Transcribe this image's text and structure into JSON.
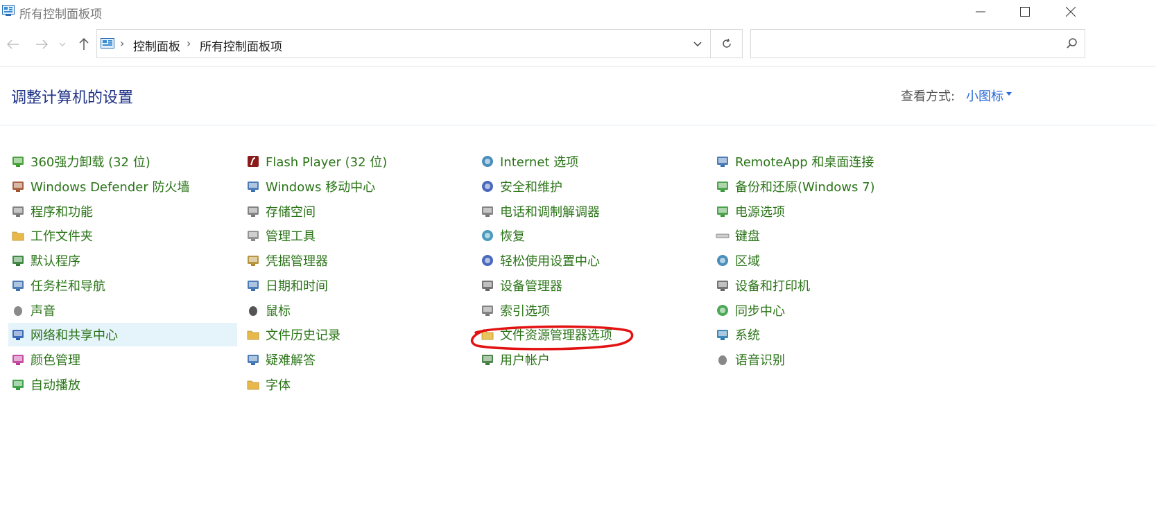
{
  "window": {
    "title": "所有控制面板项"
  },
  "address_bar": {
    "breadcrumbs": [
      "控制面板",
      "所有控制面板项"
    ]
  },
  "search": {
    "placeholder": ""
  },
  "header": {
    "title": "调整计算机的设置",
    "view_label": "查看方式:",
    "view_value": "小图标"
  },
  "columns": [
    {
      "items": [
        {
          "label": "360强力卸载 (32 位)",
          "icon": "uninstall-icon",
          "color": "#3a9a2a"
        },
        {
          "label": "Windows Defender 防火墙",
          "icon": "firewall-icon",
          "color": "#a0522d"
        },
        {
          "label": "程序和功能",
          "icon": "programs-icon",
          "color": "#777777"
        },
        {
          "label": "工作文件夹",
          "icon": "work-folder-icon",
          "color": "#e8b94a"
        },
        {
          "label": "默认程序",
          "icon": "default-programs-icon",
          "color": "#2e7d32"
        },
        {
          "label": "任务栏和导航",
          "icon": "taskbar-icon",
          "color": "#3a6fb0"
        },
        {
          "label": "声音",
          "icon": "speaker-icon",
          "color": "#8a8a8a"
        },
        {
          "label": "网络和共享中心",
          "icon": "network-icon",
          "color": "#2a5db0",
          "selected": true
        },
        {
          "label": "颜色管理",
          "icon": "color-management-icon",
          "color": "#c03a9a"
        },
        {
          "label": "自动播放",
          "icon": "autoplay-icon",
          "color": "#2e9a3a"
        }
      ]
    },
    {
      "items": [
        {
          "label": "Flash Player (32 位)",
          "icon": "flash-icon",
          "color": "#8b1a1a"
        },
        {
          "label": "Windows 移动中心",
          "icon": "mobility-center-icon",
          "color": "#3a6fb0"
        },
        {
          "label": "存储空间",
          "icon": "storage-icon",
          "color": "#777777"
        },
        {
          "label": "管理工具",
          "icon": "admin-tools-icon",
          "color": "#888888"
        },
        {
          "label": "凭据管理器",
          "icon": "credential-icon",
          "color": "#b08a2a"
        },
        {
          "label": "日期和时间",
          "icon": "calendar-icon",
          "color": "#3a6fb0"
        },
        {
          "label": "鼠标",
          "icon": "mouse-icon",
          "color": "#555555"
        },
        {
          "label": "文件历史记录",
          "icon": "file-history-icon",
          "color": "#e8b94a"
        },
        {
          "label": "疑难解答",
          "icon": "troubleshoot-icon",
          "color": "#3a6fb0"
        },
        {
          "label": "字体",
          "icon": "fonts-icon",
          "color": "#e8b94a"
        }
      ]
    },
    {
      "items": [
        {
          "label": "Internet 选项",
          "icon": "internet-options-icon",
          "color": "#2a7ab0"
        },
        {
          "label": "安全和维护",
          "icon": "flag-icon",
          "color": "#2a4db0"
        },
        {
          "label": "电话和调制解调器",
          "icon": "phone-icon",
          "color": "#777777"
        },
        {
          "label": "恢复",
          "icon": "recovery-icon",
          "color": "#2a8ab0"
        },
        {
          "label": "轻松使用设置中心",
          "icon": "ease-of-access-icon",
          "color": "#2a4db0"
        },
        {
          "label": "设备管理器",
          "icon": "device-manager-icon",
          "color": "#666666"
        },
        {
          "label": "索引选项",
          "icon": "indexing-icon",
          "color": "#777777"
        },
        {
          "label": "文件资源管理器选项",
          "icon": "folder-options-icon",
          "color": "#e8c45a"
        },
        {
          "label": "用户帐户",
          "icon": "user-accounts-icon",
          "color": "#3a7a3a"
        }
      ]
    },
    {
      "items": [
        {
          "label": "RemoteApp 和桌面连接",
          "icon": "remoteapp-icon",
          "color": "#3a6fb0"
        },
        {
          "label": "备份和还原(Windows 7)",
          "icon": "backup-icon",
          "color": "#3a9a3a"
        },
        {
          "label": "电源选项",
          "icon": "power-icon",
          "color": "#3a9a3a"
        },
        {
          "label": "键盘",
          "icon": "keyboard-icon",
          "color": "#888888"
        },
        {
          "label": "区域",
          "icon": "region-icon",
          "color": "#2a7ab0"
        },
        {
          "label": "设备和打印机",
          "icon": "printer-icon",
          "color": "#666666"
        },
        {
          "label": "同步中心",
          "icon": "sync-icon",
          "color": "#2e9a3a"
        },
        {
          "label": "系统",
          "icon": "system-icon",
          "color": "#2a7ab0"
        },
        {
          "label": "语音识别",
          "icon": "microphone-icon",
          "color": "#888888"
        }
      ]
    }
  ],
  "colors": {
    "link": "#2b7418",
    "title": "#1e3287",
    "accent": "#2a6ad6",
    "selected_bg": "#e5f3fb",
    "annotation": "#e31212"
  }
}
